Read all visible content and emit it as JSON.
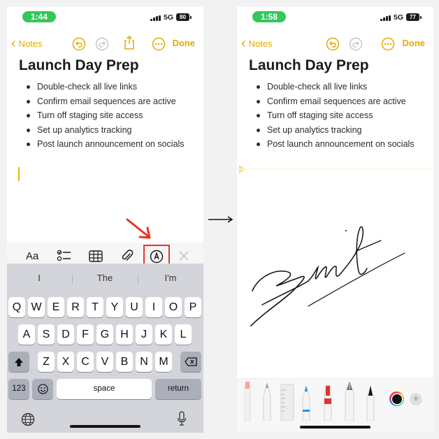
{
  "left_screen": {
    "status": {
      "time": "1:44",
      "network": "5G",
      "battery": "80"
    },
    "nav": {
      "back_label": "Notes",
      "done_label": "Done"
    },
    "note": {
      "title": "Launch Day Prep",
      "items": [
        "Double-check all live links",
        "Confirm email sequences are active",
        "Turn off staging site access",
        "Set up analytics tracking",
        "Post launch announcement on socials"
      ]
    },
    "toolbar": {
      "format_label": "Aa",
      "icons": [
        "checklist-icon",
        "table-icon",
        "attachment-icon",
        "markup-icon",
        "close-icon"
      ],
      "highlight_color": "#ea3323"
    },
    "suggestions": [
      "I",
      "The",
      "I'm"
    ],
    "keyboard": {
      "row1": [
        "Q",
        "W",
        "E",
        "R",
        "T",
        "Y",
        "U",
        "I",
        "O",
        "P"
      ],
      "row2": [
        "A",
        "S",
        "D",
        "F",
        "G",
        "H",
        "J",
        "K",
        "L"
      ],
      "row3": [
        "Z",
        "X",
        "C",
        "V",
        "B",
        "N",
        "M"
      ],
      "numbers_label": "123",
      "space_label": "space",
      "return_label": "return"
    }
  },
  "right_screen": {
    "status": {
      "time": "1:58",
      "network": "5G",
      "battery": "77"
    },
    "nav": {
      "back_label": "Notes",
      "done_label": "Done"
    },
    "note": {
      "title": "Launch Day Prep",
      "items": [
        "Double-check all live links",
        "Confirm email sequences are active",
        "Turn off staging site access",
        "Set up analytics tracking",
        "Post launch announcement on socials"
      ]
    },
    "drawing_tools": [
      "marker-tool",
      "pencil-tool",
      "ruler-tool",
      "pen-tool",
      "crayon-tool",
      "fountain-pen-tool",
      "brush-tool"
    ],
    "selected_color": "#111111"
  },
  "colors": {
    "accent": "#e3aa00",
    "status_pill": "#34c759"
  }
}
